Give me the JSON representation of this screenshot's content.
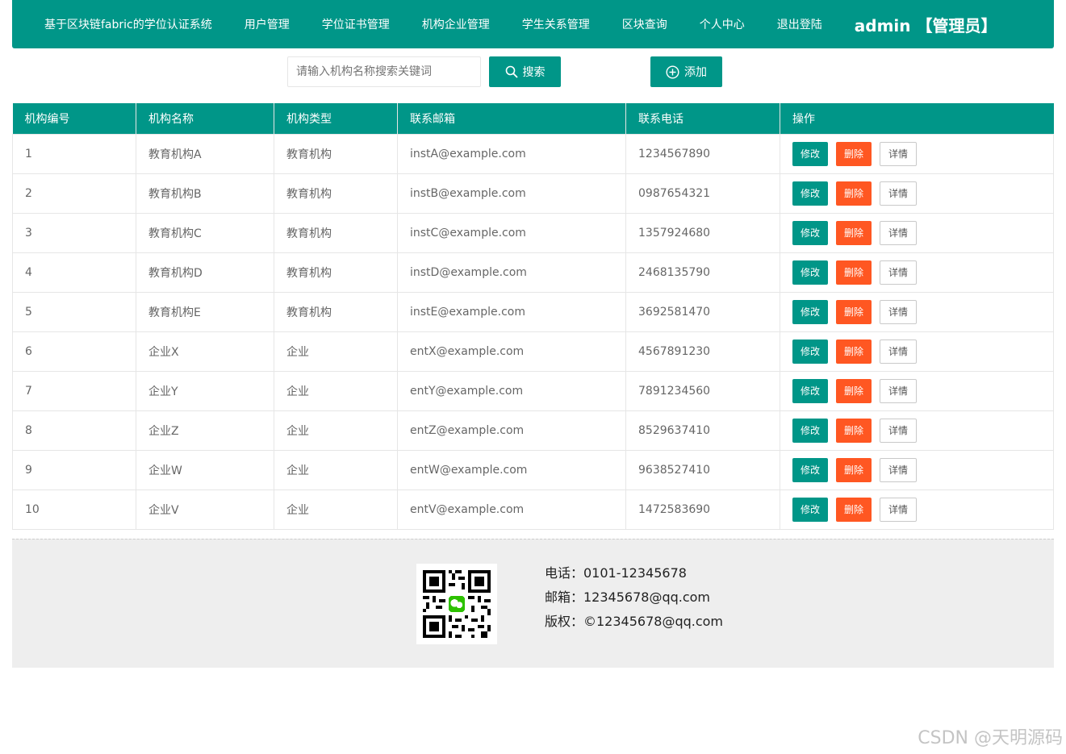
{
  "nav": {
    "brand": "基于区块链fabric的学位认证系统",
    "items": [
      "用户管理",
      "学位证书管理",
      "机构企业管理",
      "学生关系管理",
      "区块查询",
      "个人中心",
      "退出登陆"
    ],
    "user": "admin 【管理员】"
  },
  "toolbar": {
    "search_placeholder": "请输入机构名称搜索关键词",
    "search_label": "搜索",
    "add_label": "添加"
  },
  "table": {
    "headers": [
      "机构编号",
      "机构名称",
      "机构类型",
      "联系邮箱",
      "联系电话",
      "操作"
    ],
    "rows": [
      [
        "1",
        "教育机构A",
        "教育机构",
        "instA@example.com",
        "1234567890"
      ],
      [
        "2",
        "教育机构B",
        "教育机构",
        "instB@example.com",
        "0987654321"
      ],
      [
        "3",
        "教育机构C",
        "教育机构",
        "instC@example.com",
        "1357924680"
      ],
      [
        "4",
        "教育机构D",
        "教育机构",
        "instD@example.com",
        "2468135790"
      ],
      [
        "5",
        "教育机构E",
        "教育机构",
        "instE@example.com",
        "3692581470"
      ],
      [
        "6",
        "企业X",
        "企业",
        "entX@example.com",
        "4567891230"
      ],
      [
        "7",
        "企业Y",
        "企业",
        "entY@example.com",
        "7891234560"
      ],
      [
        "8",
        "企业Z",
        "企业",
        "entZ@example.com",
        "8529637410"
      ],
      [
        "9",
        "企业W",
        "企业",
        "entW@example.com",
        "9638527410"
      ],
      [
        "10",
        "企业V",
        "企业",
        "entV@example.com",
        "1472583690"
      ]
    ],
    "actions": {
      "edit": "修改",
      "delete": "删除",
      "detail": "详情"
    }
  },
  "footer": {
    "phone": "电话：0101-12345678",
    "email": "邮箱：12345678@qq.com",
    "copyright": "版权：©12345678@qq.com"
  },
  "watermark": "CSDN @天明源码",
  "colors": {
    "primary": "#009688",
    "danger": "#FF5722",
    "footer_bg": "#eeeeee"
  },
  "icons": {
    "search": "search-icon",
    "add": "plus-circle-icon",
    "qr": "wechat-qr-code"
  }
}
